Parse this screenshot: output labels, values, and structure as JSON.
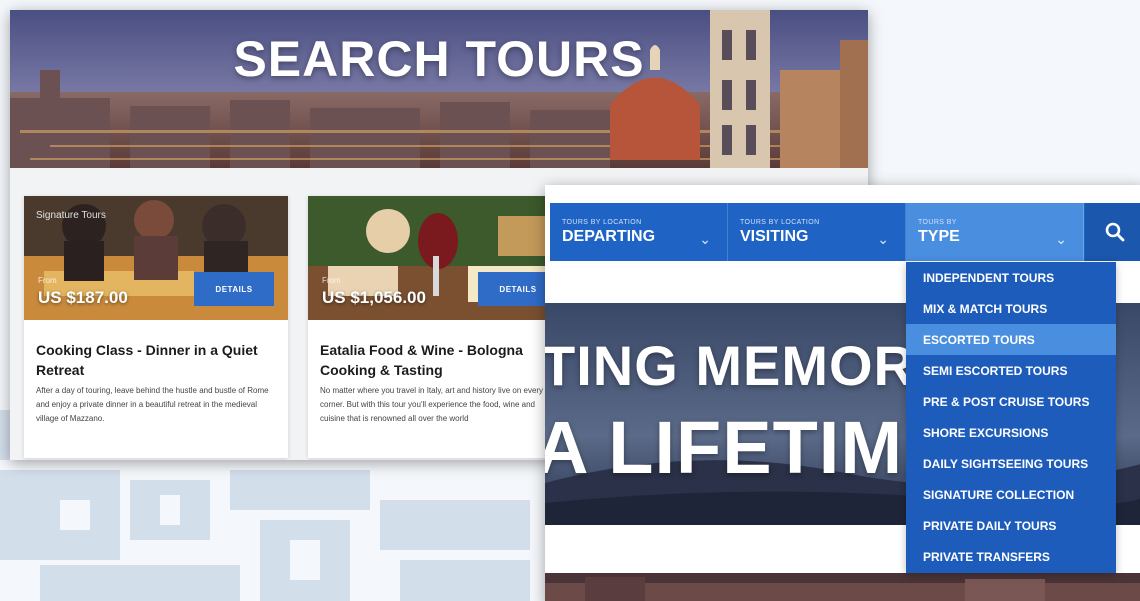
{
  "left_page": {
    "hero_title": "SEARCH TOURS",
    "cards": [
      {
        "tag": "Signature Tours",
        "price_label": "From",
        "price": "US $187.00",
        "details_label": "DETAILS",
        "title": "Cooking Class - Dinner in a Quiet Retreat",
        "description": "After a day of touring, leave behind the hustle and bustle of Rome and enjoy a private dinner in a beautiful retreat in the medieval village of Mazzano."
      },
      {
        "tag": "",
        "price_label": "From",
        "price": "US $1,056.00",
        "details_label": "DETAILS",
        "title": "Eatalia Food & Wine - Bologna Cooking & Tasting",
        "description": "No matter where you travel in Italy, art and history live on every corner. But with this tour you'll experience the food, wine and cuisine that is renowned all over the world"
      }
    ]
  },
  "right_page": {
    "nav": [
      {
        "small": "TOURS BY LOCATION",
        "label": "DEPARTING",
        "icon": "chevron-down-icon"
      },
      {
        "small": "TOURS BY LOCATION",
        "label": "VISITING",
        "icon": "chevron-down-icon"
      },
      {
        "small": "TOURS BY",
        "label": "TYPE",
        "icon": "chevron-down-icon"
      }
    ],
    "search_icon": "search-icon",
    "hero_line1": "TING MEMOR",
    "hero_line2": "A LIFETIM",
    "dropdown": {
      "items": [
        "INDEPENDENT TOURS",
        "MIX & MATCH TOURS",
        "ESCORTED TOURS",
        "SEMI ESCORTED TOURS",
        "PRE & POST CRUISE TOURS",
        "SHORE EXCURSIONS",
        "DAILY SIGHTSEEING TOURS",
        "SIGNATURE COLLECTION",
        "PRIVATE DAILY TOURS",
        "PRIVATE TRANSFERS"
      ],
      "highlighted": "ESCORTED TOURS"
    }
  },
  "colors": {
    "nav_blue": "#1f64c4",
    "highlight_blue": "#4a8ee0",
    "button_blue": "#2f6cc7"
  }
}
